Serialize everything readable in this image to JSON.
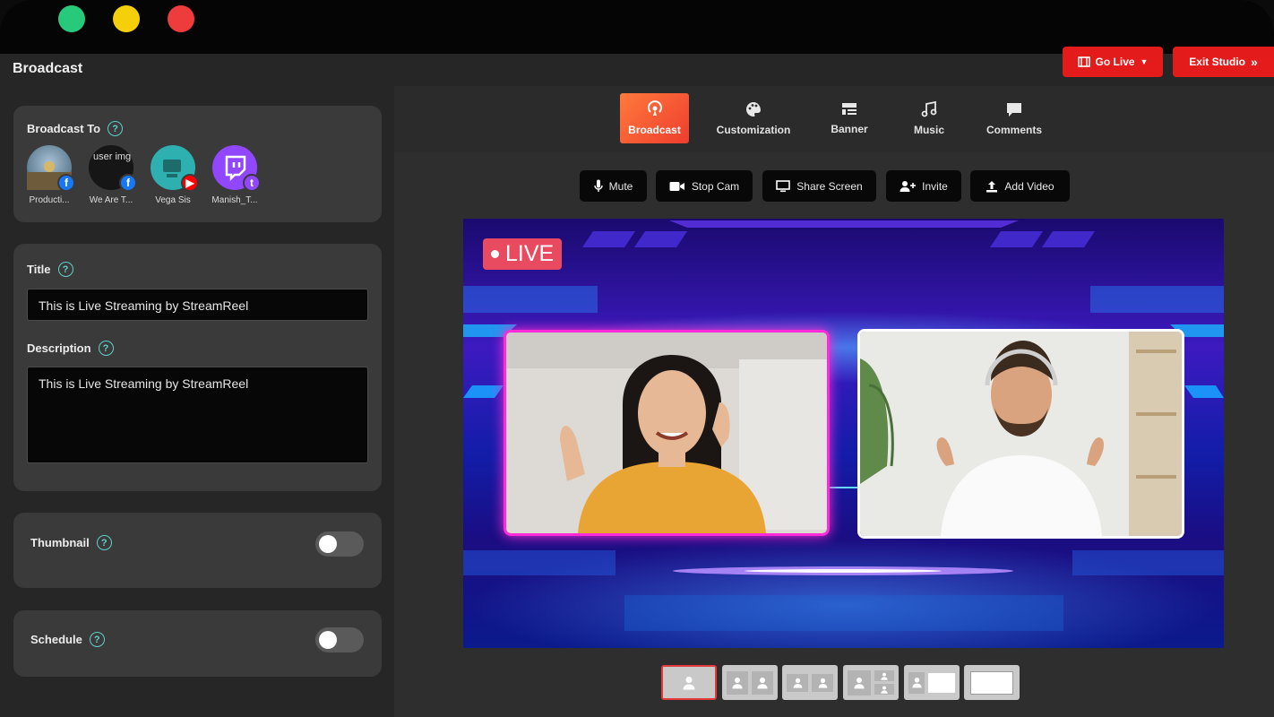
{
  "window": {
    "dots": [
      {
        "name": "window-green-dot",
        "color": "#27c97a"
      },
      {
        "name": "window-yellow-dot",
        "color": "#f5cf0a"
      },
      {
        "name": "window-red-dot",
        "color": "#ee3b3b"
      }
    ]
  },
  "header": {
    "title": "Broadcast",
    "go_live_label": "Go Live",
    "exit_studio_label": "Exit Studio",
    "accent_color": "#e31b1b"
  },
  "sidebar": {
    "broadcast_to": {
      "label": "Broadcast To",
      "accounts": [
        {
          "name": "Producti...",
          "platform": "facebook",
          "badge_icon": "facebook-icon"
        },
        {
          "name": "We Are T...",
          "platform": "facebook",
          "badge_icon": "facebook-icon",
          "broken_image_alt": "user img"
        },
        {
          "name": "Vega Sis",
          "platform": "youtube",
          "badge_icon": "youtube-icon"
        },
        {
          "name": "Manish_T...",
          "platform": "twitch",
          "badge_icon": "twitch-icon"
        }
      ]
    },
    "title_label": "Title",
    "title_value": "This is Live Streaming by StreamReel",
    "description_label": "Description",
    "description_value": "This is Live Streaming by StreamReel",
    "thumbnail_label": "Thumbnail",
    "thumbnail_enabled": false,
    "schedule_label": "Schedule",
    "schedule_enabled": false
  },
  "tabs": [
    {
      "label": "Broadcast",
      "icon": "broadcast-icon",
      "active": true
    },
    {
      "label": "Customization",
      "icon": "palette-icon",
      "active": false
    },
    {
      "label": "Banner",
      "icon": "banner-icon",
      "active": false
    },
    {
      "label": "Music",
      "icon": "music-icon",
      "active": false
    },
    {
      "label": "Comments",
      "icon": "comment-icon",
      "active": false
    }
  ],
  "controls": [
    {
      "label": "Mute",
      "icon": "microphone-icon"
    },
    {
      "label": "Stop Cam",
      "icon": "video-camera-icon"
    },
    {
      "label": "Share Screen",
      "icon": "monitor-icon"
    },
    {
      "label": "Invite",
      "icon": "add-user-icon"
    },
    {
      "label": "Add Video",
      "icon": "upload-icon"
    }
  ],
  "stage": {
    "live_label": "LIVE",
    "participants": [
      {
        "name": "participant-woman",
        "frame_color": "#ff2bd6"
      },
      {
        "name": "participant-man",
        "frame_color": "#ffffff"
      }
    ]
  },
  "layouts": [
    {
      "name": "layout-single",
      "active": true
    },
    {
      "name": "layout-two-split",
      "active": false
    },
    {
      "name": "layout-two-side",
      "active": false
    },
    {
      "name": "layout-grid",
      "active": false
    },
    {
      "name": "layout-presenter-screen",
      "active": false
    },
    {
      "name": "layout-screen-only",
      "active": false
    }
  ]
}
